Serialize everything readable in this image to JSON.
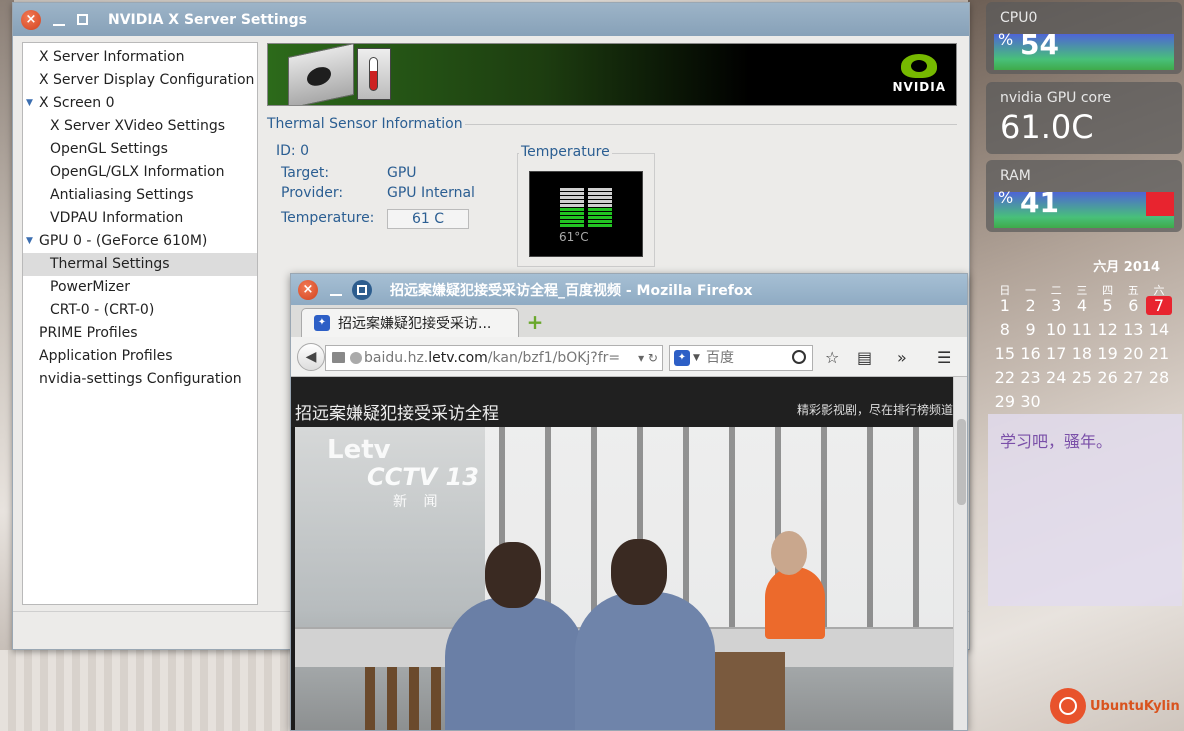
{
  "nvidia": {
    "title": "NVIDIA X Server Settings",
    "logo_text": "NVIDIA",
    "tree": [
      {
        "label": "X Server Information",
        "level": 0
      },
      {
        "label": "X Server Display Configuration",
        "level": 0
      },
      {
        "label": "X Screen 0",
        "level": 0,
        "expanded": true
      },
      {
        "label": "X Server XVideo Settings",
        "level": 1
      },
      {
        "label": "OpenGL Settings",
        "level": 1
      },
      {
        "label": "OpenGL/GLX Information",
        "level": 1
      },
      {
        "label": "Antialiasing Settings",
        "level": 1
      },
      {
        "label": "VDPAU Information",
        "level": 1
      },
      {
        "label": "GPU 0 - (GeForce 610M)",
        "level": 0,
        "expanded": true
      },
      {
        "label": "Thermal Settings",
        "level": 1,
        "selected": true
      },
      {
        "label": "PowerMizer",
        "level": 1
      },
      {
        "label": "CRT-0 - (CRT-0)",
        "level": 1
      },
      {
        "label": "PRIME Profiles",
        "level": 0
      },
      {
        "label": "Application Profiles",
        "level": 0
      },
      {
        "label": "nvidia-settings Configuration",
        "level": 0
      }
    ],
    "thermal": {
      "section_title": "Thermal Sensor Information",
      "id_label": "ID: 0",
      "target_label": "Target:",
      "target_value": "GPU",
      "provider_label": "Provider:",
      "provider_value": "GPU Internal",
      "temperature_label": "Temperature:",
      "temperature_value": "61 C",
      "gauge_title": "Temperature",
      "gauge_text": "61°C",
      "gauge_level": 0.45
    }
  },
  "firefox": {
    "title": "招远案嫌疑犯接受采访全程_百度视频 - Mozilla Firefox",
    "tab_label": "招远案嫌疑犯接受采访...",
    "url_domain": "baidu.hz.",
    "url_host": "letv.com",
    "url_path": "/kan/bzf1/bOKj?fr=",
    "search_placeholder": "百度",
    "page_title": "招远案嫌疑犯接受采访全程",
    "page_slogan": "精彩影视剧，尽在排行榜频道",
    "video_logo_letv": "Letv",
    "video_logo_cctv": "CCTV 13",
    "video_logo_news": "新 闻"
  },
  "widgets": {
    "cpu_label": "CPU0",
    "cpu_pct_sign": "%",
    "cpu_value": "54",
    "gpu_label": "nvidia GPU core",
    "gpu_value": "61.0C",
    "ram_label": "RAM",
    "ram_pct_sign": "%",
    "ram_value": "41"
  },
  "calendar": {
    "month_label": "六月 2014",
    "weekdays": [
      "日",
      "一",
      "二",
      "三",
      "四",
      "五",
      "六"
    ],
    "weeks": [
      [
        "1",
        "2",
        "3",
        "4",
        "5",
        "6",
        "7"
      ],
      [
        "8",
        "9",
        "10",
        "11",
        "12",
        "13",
        "14"
      ],
      [
        "15",
        "16",
        "17",
        "18",
        "19",
        "20",
        "21"
      ],
      [
        "22",
        "23",
        "24",
        "25",
        "26",
        "27",
        "28"
      ],
      [
        "29",
        "30",
        "",
        "",
        "",
        "",
        ""
      ]
    ],
    "today": "7"
  },
  "note_text": "学习吧，骚年。",
  "desktop_logo": "UbuntuKylin"
}
